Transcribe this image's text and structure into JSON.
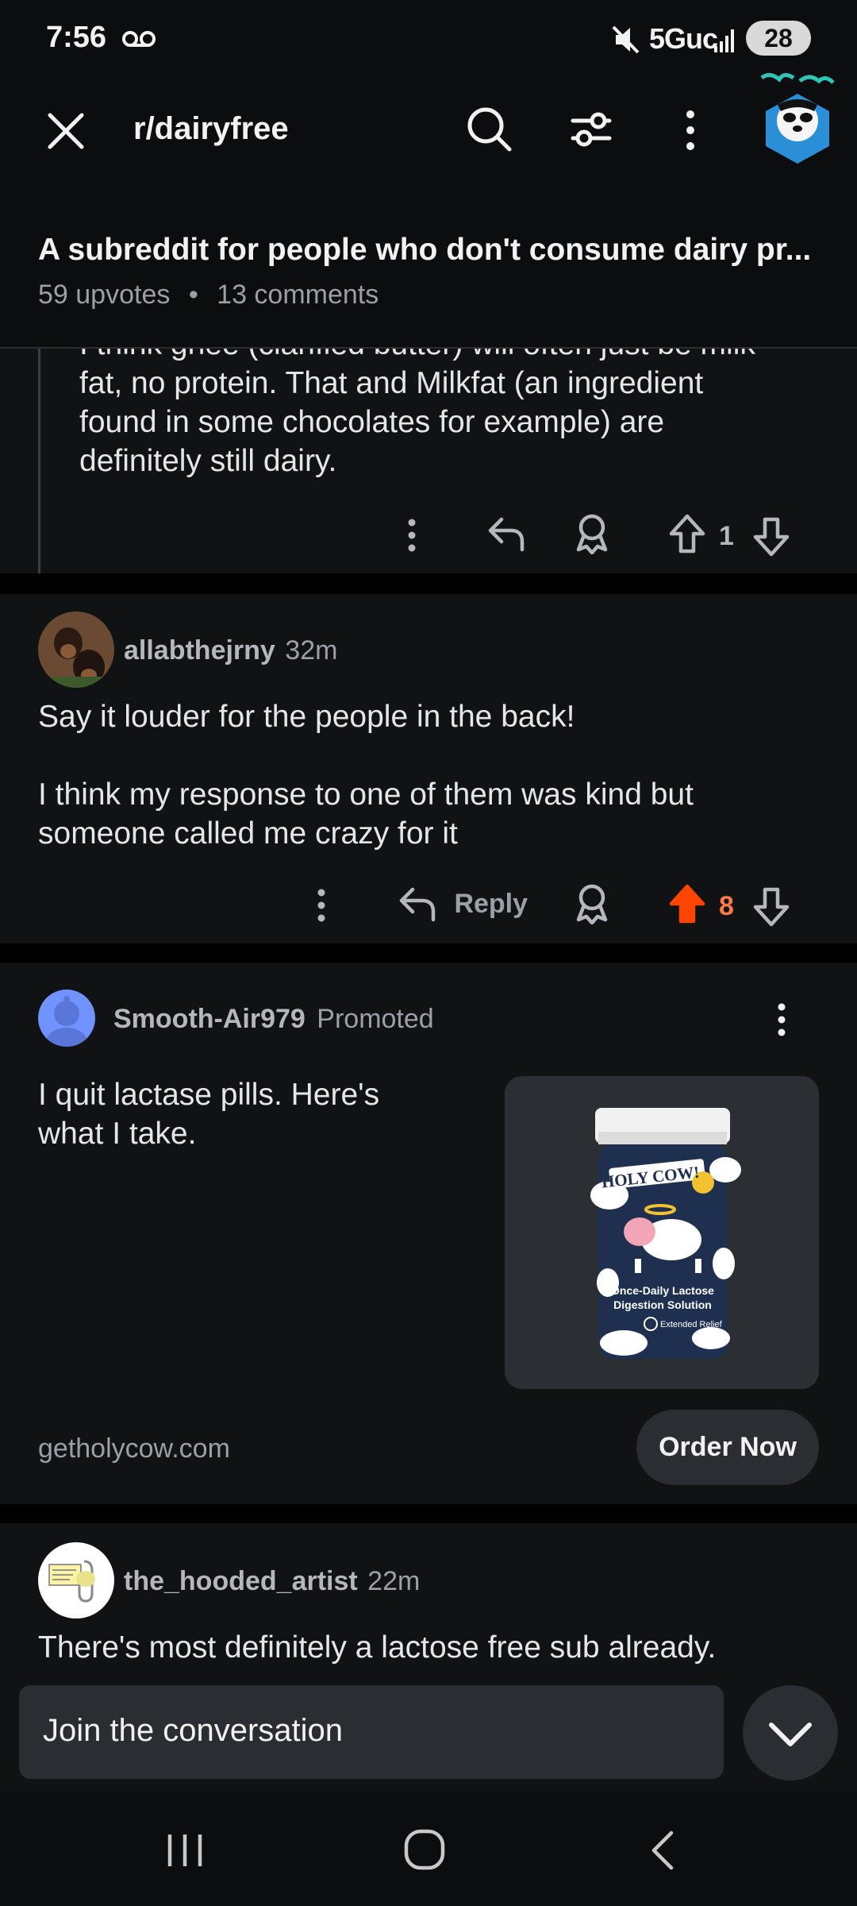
{
  "status_bar": {
    "time": "7:56",
    "network": "5Guc",
    "battery": "28"
  },
  "header": {
    "subreddit": "r/dairyfree"
  },
  "post": {
    "title": "A subreddit for people who don't consume dairy pr...",
    "upvotes": "59 upvotes",
    "separator": "•",
    "comments": "13 comments"
  },
  "comments": [
    {
      "text_lines": [
        "I think ghee (clarified butter) will often just be milk",
        "fat, no protein. That and Milkfat (an ingredient",
        "found in some chocolates for example) are",
        "definitely still dairy."
      ],
      "votes": "1"
    },
    {
      "user": "allabthejrny",
      "time": "32m",
      "text_line1": "Say it louder for the people in the back!",
      "text_line2": "I think my response to one of them was kind but",
      "text_line3": "someone called me crazy for it",
      "reply_label": "Reply",
      "votes": "8",
      "upvote_color": "#ff4500"
    }
  ],
  "ad": {
    "user": "Smooth-Air979",
    "tag": "Promoted",
    "text_line1": "I quit lactase pills. Here's",
    "text_line2": "what I take.",
    "domain": "getholycow.com",
    "cta": "Order Now",
    "product_brand": "HOLY COW!",
    "product_line1": "Once-Daily Lactose",
    "product_line2": "Digestion Solution",
    "product_badge": "Extended Relief"
  },
  "last_comment": {
    "user": "the_hooded_artist",
    "time": "22m",
    "text": "There's most definitely a lactose free sub already."
  },
  "composer": {
    "placeholder": "Join the conversation"
  }
}
